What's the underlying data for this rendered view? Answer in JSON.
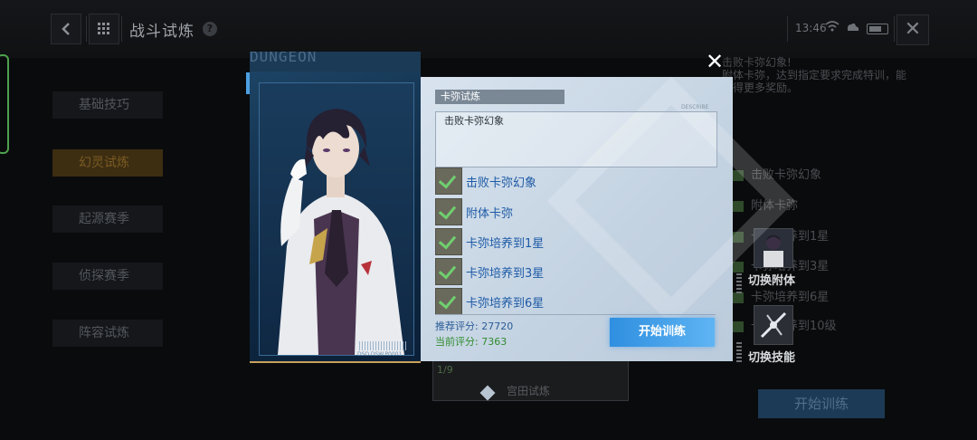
{
  "topbar": {
    "title": "战斗试炼",
    "help_icon": "?",
    "time": "13:46"
  },
  "sidebar": {
    "items": [
      {
        "label": "基础技巧",
        "active": false
      },
      {
        "label": "幻灵试炼",
        "active": true
      },
      {
        "label": "起源赛季",
        "active": false
      },
      {
        "label": "侦探赛季",
        "active": false
      },
      {
        "label": "阵容试炼",
        "active": false
      }
    ]
  },
  "background": {
    "info_line1": "击败卡弥幻象!",
    "info_line2": "附体卡弥，达到指定要求完成特训，能",
    "info_line3": "获得更多奖励。",
    "objectives": [
      "击败卡弥幻象",
      "附体卡弥",
      "卡弥培养到1星",
      "卡弥培养到3星",
      "卡弥培养到6星",
      "卡弥培养到10级"
    ],
    "switch_attach_label": "切换附体",
    "switch_skill_label": "切换技能",
    "start_label": "开始训练",
    "card_count": "1/9",
    "card_label": "宫田试炼"
  },
  "modal": {
    "dungeon_text": "DUNGEON",
    "barcode_text": "DSO.DSW.P0001",
    "panel_title": "卡弥试炼",
    "desc_tag": "DESCRIBE",
    "description": "击败卡弥幻象",
    "tasks": [
      "击败卡弥幻象",
      "附体卡弥",
      "卡弥培养到1星",
      "卡弥培养到3星",
      "卡弥培养到6星"
    ],
    "recommended_score": "推荐评分: 27720",
    "current_score": "当前评分: 7363",
    "start_button": "开始训练",
    "close_icon": "✕"
  },
  "colors": {
    "accent_blue": "#3d9ae6",
    "task_text_blue": "#1d5aa6",
    "current_score_green": "#2f8c2f",
    "active_side_gold": "#3d2e12"
  }
}
